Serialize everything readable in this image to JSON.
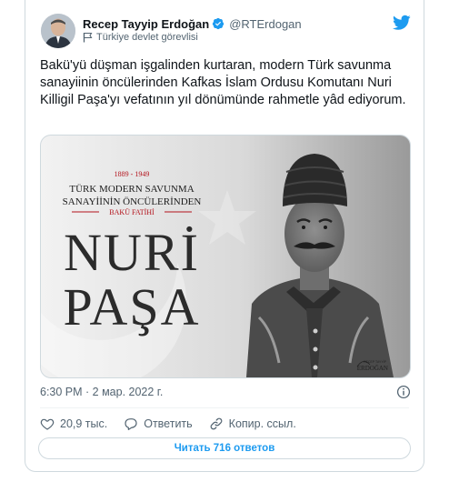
{
  "author": {
    "display_name": "Recep Tayyip Erdoğan",
    "handle": "@RTErdogan",
    "label": "Türkiye devlet görevlisi"
  },
  "tweet": {
    "text": "Bakü'yü düşman işgalinden kurtaran, modern Türk savunma sanayiinin öncülerinden Kafkas İslam Ordusu Komutanı Nuri Killigil Paşa'yı vefatının yıl dönümünde rahmetle yâd ediyorum.",
    "timestamp": "6:30 PM · 2 мар. 2022 г."
  },
  "media": {
    "years": "1889 - 1949",
    "line1": "TÜRK MODERN SAVUNMA",
    "line2": "SANAYİİNİN ÖNCÜLERİNDEN",
    "line3": "BAKÜ FATİHİ",
    "big1": "NURİ",
    "big2": "PAŞA",
    "signature_top": "RECEP TAYYİP",
    "signature": "ERDOĞAN"
  },
  "actions": {
    "likes": "20,9 тыс.",
    "reply": "Ответить",
    "copy_link": "Копир. ссыл."
  },
  "read_replies": "Читать 716 ответов",
  "colors": {
    "twitter_blue": "#1d9bf0",
    "verified_blue": "#1d9bf0",
    "text_secondary": "#536471",
    "accent_red": "#b3121b"
  }
}
